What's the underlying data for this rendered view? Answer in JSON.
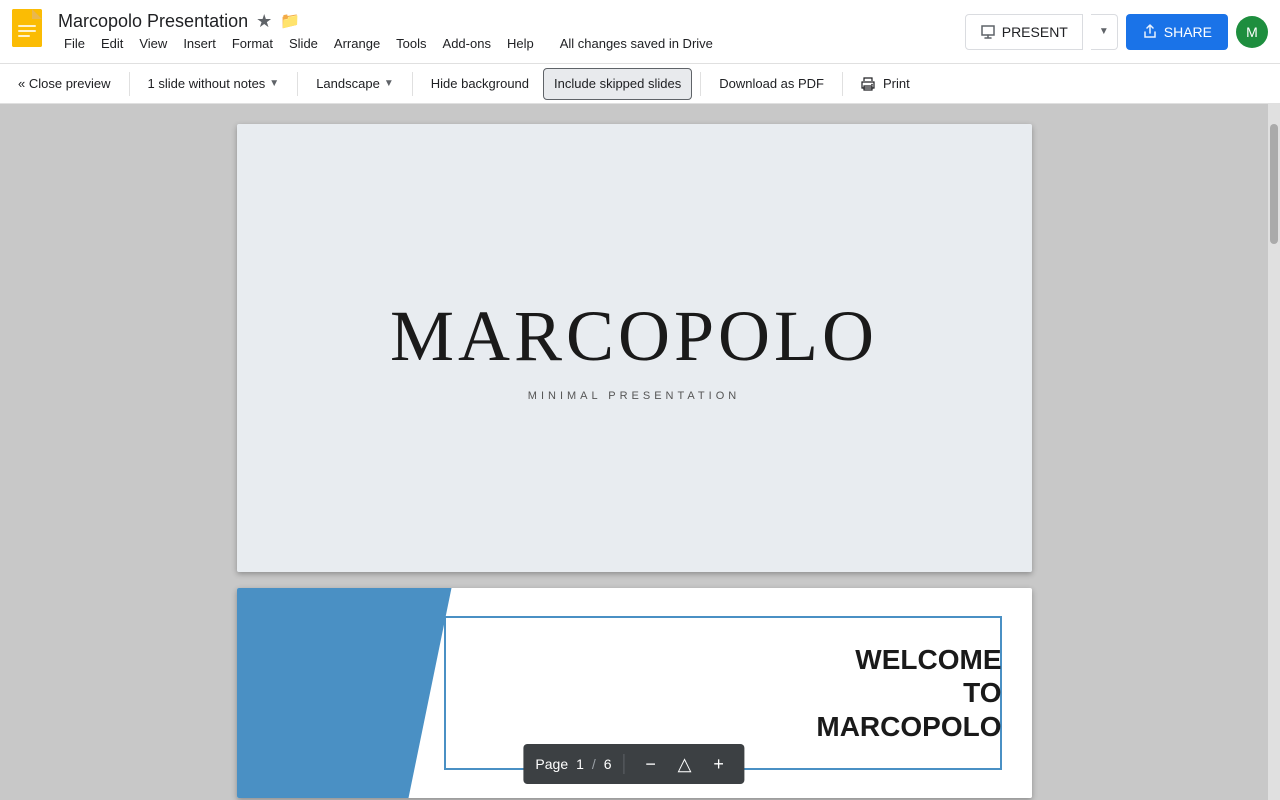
{
  "app": {
    "icon_color": "#F4B400",
    "title": "Marcopolo Presentation",
    "star_icon": "★",
    "folder_icon": "📁"
  },
  "menu": {
    "items": [
      "File",
      "Edit",
      "View",
      "Insert",
      "Format",
      "Slide",
      "Arrange",
      "Tools",
      "Add-ons",
      "Help"
    ]
  },
  "status": {
    "text": "All changes saved in Drive"
  },
  "toolbar_right": {
    "present_label": "PRESENT",
    "share_label": "SHARE",
    "avatar_label": "M"
  },
  "toolbar": {
    "close_preview": "« Close preview",
    "slide_view": "1 slide without notes",
    "orientation": "Landscape",
    "hide_background": "Hide background",
    "include_skipped": "Include skipped slides",
    "download_pdf": "Download as PDF",
    "print": "Print"
  },
  "slide1": {
    "title": "MARCOPOLO",
    "subtitle": "MINIMAL PRESENTATION"
  },
  "slide2": {
    "line1": "WELCOME",
    "line2": "TO",
    "line3": "MARCOPOLO"
  },
  "page_indicator": {
    "label": "Page",
    "current": "1",
    "separator": "/",
    "total": "6"
  }
}
